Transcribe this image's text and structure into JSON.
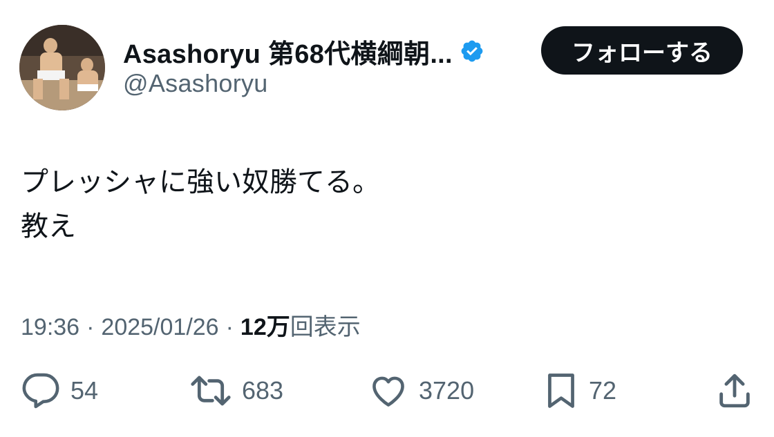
{
  "author": {
    "display_name": "Asashoryu 第68代横綱朝...",
    "handle": "@Asashoryu",
    "verified_icon": "verified-badge-icon",
    "avatar_icon": "avatar-photo"
  },
  "follow_button": {
    "label": "フォローする"
  },
  "tweet": {
    "lines": [
      "プレッシャに強い奴勝てる。",
      "教え"
    ]
  },
  "meta": {
    "time": "19:36",
    "separator": "·",
    "date": "2025/01/26",
    "views_count": "12万",
    "views_label": "回表示"
  },
  "actions": {
    "reply": {
      "icon": "reply-icon",
      "count": "54"
    },
    "repost": {
      "icon": "repost-icon",
      "count": "683"
    },
    "like": {
      "icon": "heart-icon",
      "count": "3720"
    },
    "bookmark": {
      "icon": "bookmark-icon",
      "count": "72"
    },
    "share": {
      "icon": "share-icon"
    }
  },
  "colors": {
    "text_primary": "#0f1419",
    "text_secondary": "#536471",
    "verified_blue": "#1d9bf0",
    "button_bg": "#0f1419"
  }
}
